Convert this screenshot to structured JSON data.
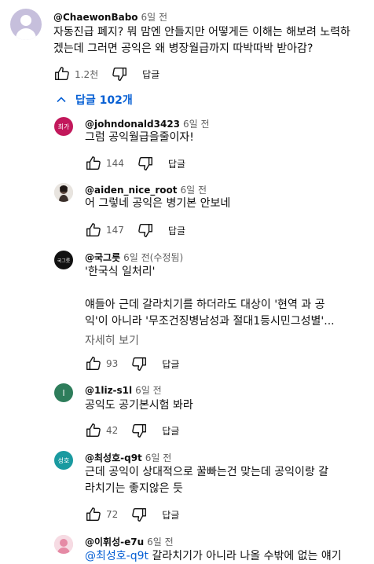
{
  "top_comment": {
    "author": "@ChaewonBabo",
    "time": "6일 전",
    "text": "자동진급 폐지? 뭐 맘엔 안들지만 어떻게든 이해는 해보려 노력하겠는데 그러면 공익은 왜 병장월급까지 따박따박 받아감?",
    "likes": "1.2천",
    "reply_label": "답글"
  },
  "replies_toggle": {
    "label": "답글 102개"
  },
  "replies": [
    {
      "author": "@johndonald3423",
      "time": "6일 전",
      "avatar_text": "최가",
      "avatar_color": "#c2185b",
      "lines": [
        "그럼 공익월급을줄이자!"
      ],
      "likes": "144",
      "reply_label": "답글"
    },
    {
      "author": "@aiden_nice_root",
      "time": "6일 전",
      "avatar_text": "",
      "avatar_color": "#d9d4cf",
      "lines": [
        "어 그렇네 공익은 병기본 안보네"
      ],
      "likes": "147",
      "reply_label": "답글"
    },
    {
      "author": "@국그릇",
      "time": "6일 전(수정됨)",
      "avatar_text": "국그릇",
      "avatar_color": "#111111",
      "lines": [
        "'한국식 일처리'",
        "",
        "얘들아 근데 갈라치기를 하더라도 대상이 '현역 과 공",
        "익'이 아니라 '무조건징병남성과 절대1등시민그성별'..."
      ],
      "more_label": "자세히 보기",
      "likes": "93",
      "reply_label": "답글"
    },
    {
      "author": "@1liz-s1l",
      "time": "6일 전",
      "avatar_text": "l",
      "avatar_color": "#2e7d5b",
      "lines": [
        "공익도 공기본시험 봐라"
      ],
      "likes": "42",
      "reply_label": "답글"
    },
    {
      "author": "@최성호-q9t",
      "time": "6일 전",
      "avatar_text": "성호",
      "avatar_color": "#1a9aa0",
      "lines": [
        "근데 공익이 상대적으로 꿀빠는건 맞는데 공익이랑 갈",
        "라치기는 좋지않은 듯"
      ],
      "likes": "72",
      "reply_label": "답글"
    },
    {
      "author": "@이휘성-e7u",
      "time": "6일 전",
      "avatar_text": "",
      "avatar_color": "#f3c7d3",
      "mention": "@최성호-q9t",
      "lines": [
        "갈라치기가 아니라 나올 수밖에 없는 얘기"
      ]
    }
  ],
  "icons": {
    "like": "thumbs-up-icon",
    "dislike": "thumbs-down-icon",
    "toggle": "chevron-up-icon"
  },
  "colors": {
    "link": "#065fd4",
    "secondary_text": "#606060"
  }
}
